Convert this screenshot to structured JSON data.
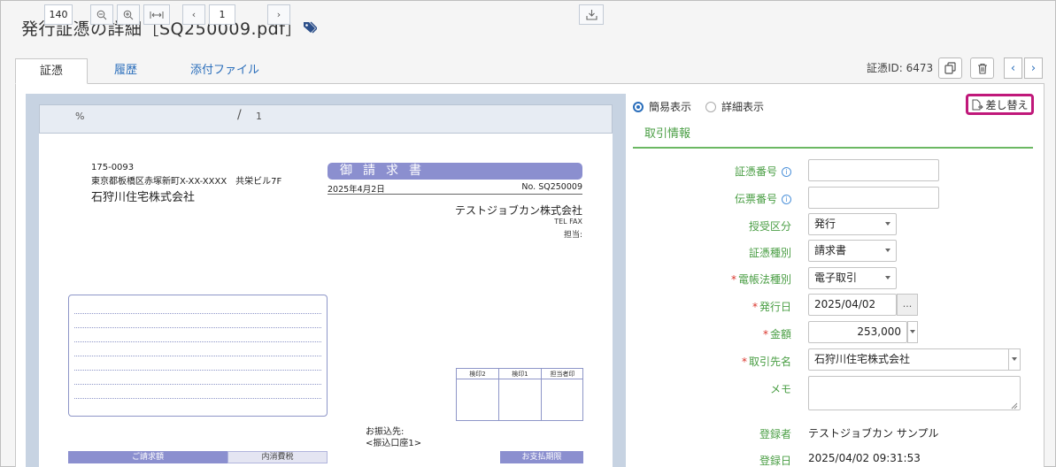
{
  "header": {
    "title": "発行証憑の詳細［SQ250009.pdf］",
    "tag_icon": "tag-icon"
  },
  "tabs": [
    {
      "label": "証憑",
      "active": true
    },
    {
      "label": "履歴",
      "active": false
    },
    {
      "label": "添付ファイル",
      "active": false
    }
  ],
  "record": {
    "id_label": "証憑ID: 6473"
  },
  "viewer": {
    "zoom": "140",
    "zoom_unit": "%",
    "page_current": "1",
    "page_separator": "/",
    "page_total": "1"
  },
  "document": {
    "postal": "175-0093",
    "address": "東京都板橋区赤塚新町X-XX-XXXX　共栄ビル7F",
    "client": "石狩川住宅株式会社",
    "banner": "御請求書",
    "date": "2025年4月2日",
    "number": "No. SQ250009",
    "issuer": "テストジョブカン株式会社",
    "tel_fax": "TEL FAX",
    "tanto": "担当:",
    "stamp_headers": [
      "検印2",
      "検印1",
      "担当者印"
    ],
    "furikomi_label": "お振込先:",
    "furikomi_value": "<振込口座1>",
    "amount_label": "ご請求額",
    "tax_label": "内消費税",
    "due_label": "お支払期限"
  },
  "view_mode": {
    "simple": "簡易表示",
    "detail": "詳細表示",
    "selected": "simple"
  },
  "replace_button": "差し替え",
  "section": {
    "title": "取引情報"
  },
  "form": {
    "voucher_no_label": "証憑番号",
    "voucher_no_value": "",
    "slip_no_label": "伝票番号",
    "slip_no_value": "",
    "direction_label": "授受区分",
    "direction_value": "発行",
    "doc_type_label": "証憑種別",
    "doc_type_value": "請求書",
    "ledger_label": "電帳法種別",
    "ledger_value": "電子取引",
    "issue_date_label": "発行日",
    "issue_date_value": "2025/04/02",
    "date_picker": "...",
    "amount_label": "金額",
    "amount_value": "253,000",
    "partner_label": "取引先名",
    "partner_value": "石狩川住宅株式会社",
    "memo_label": "メモ",
    "memo_value": "",
    "registrant_label": "登録者",
    "registrant_value": "テストジョブカン サンプル",
    "registered_label": "登録日",
    "registered_value": "2025/04/02 09:31:53"
  },
  "colors": {
    "accent_blue": "#2a6ebb",
    "section_green": "#4a9e44",
    "required_red": "#d9342b",
    "highlight_magenta": "#c0187a",
    "invoice_purple": "#8b8fcf"
  }
}
